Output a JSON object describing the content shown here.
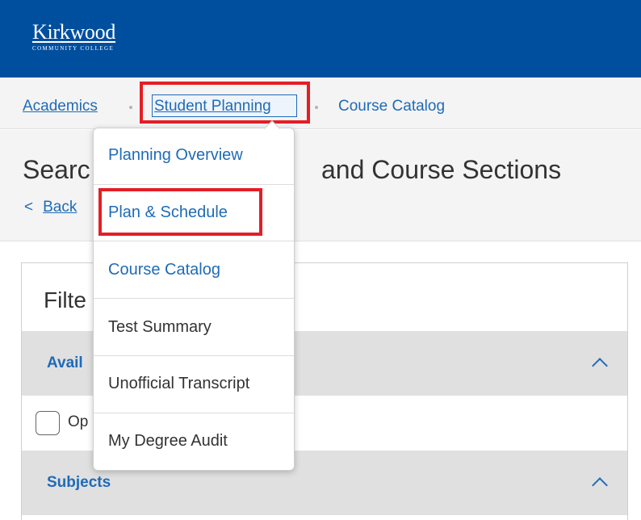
{
  "header": {
    "logo_main": "Kirkwood",
    "logo_sub": "COMMUNITY COLLEGE",
    "background": "#004f9f"
  },
  "breadcrumb": {
    "items": [
      {
        "label": "Academics"
      },
      {
        "label": "Student Planning"
      },
      {
        "label": "Course Catalog"
      }
    ]
  },
  "page": {
    "title_left": "Searc",
    "title_right": "and Course Sections",
    "back_chevron": "<",
    "back_label": "Back"
  },
  "filters": {
    "title": "Filte",
    "sections": [
      {
        "label": "Avail",
        "expanded": true,
        "icon": "chevron-up-icon"
      },
      {
        "label": "Subjects",
        "expanded": true,
        "icon": "chevron-up-icon"
      }
    ],
    "checkbox_label": "Op",
    "checkbox_checked": false
  },
  "dropdown": {
    "items": [
      {
        "label": "Planning Overview"
      },
      {
        "label": "Plan & Schedule"
      },
      {
        "label": "Course Catalog"
      },
      {
        "label": "Test Summary"
      },
      {
        "label": "Unofficial Transcript"
      },
      {
        "label": "My Degree Audit"
      }
    ]
  },
  "colors": {
    "link": "#1f6bb7",
    "highlight": "#e41e26",
    "panel_gray": "#e0e0e0"
  }
}
